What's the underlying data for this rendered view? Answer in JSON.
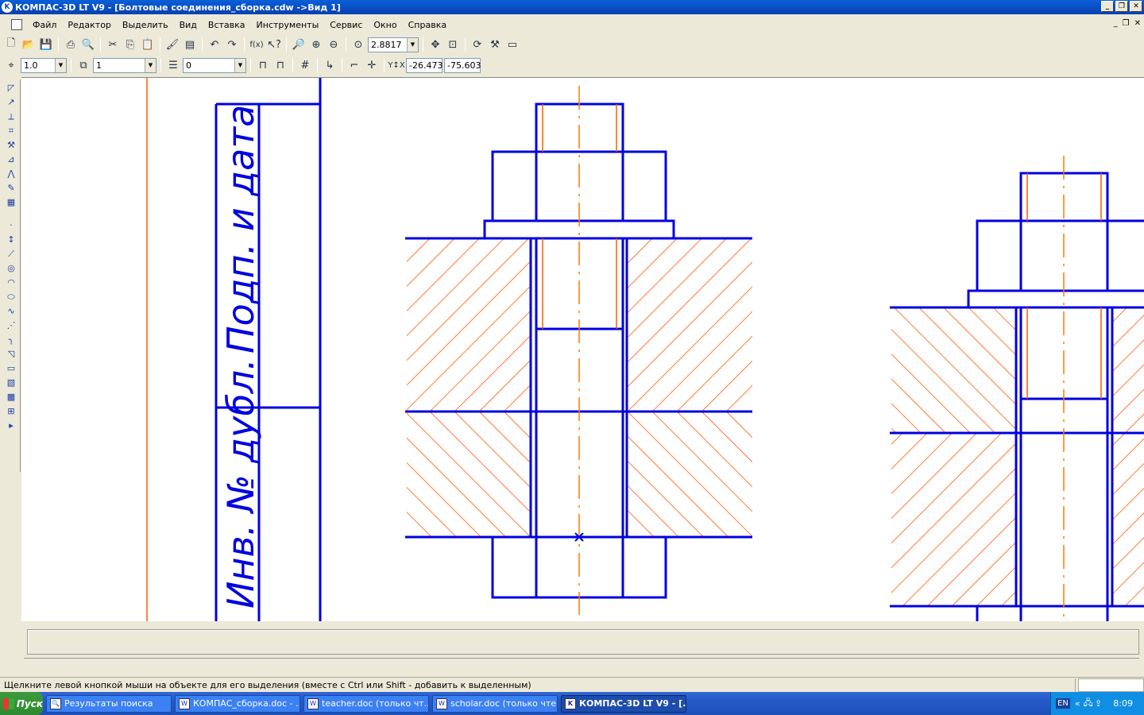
{
  "window": {
    "title": "КОМПАС-3D LT V9 - [Болтовые соединения_сборка.cdw ->Вид 1]",
    "app_icon": "kompas-icon"
  },
  "menu": {
    "items": [
      "Файл",
      "Редактор",
      "Выделить",
      "Вид",
      "Вставка",
      "Инструменты",
      "Сервис",
      "Окно",
      "Справка"
    ]
  },
  "toolbar": {
    "zoom_value": "2.8817",
    "icons": [
      "new-icon",
      "open-icon",
      "save-icon",
      "print-icon",
      "preview-icon",
      "cut-icon",
      "copy-icon",
      "paste-icon",
      "format-brush-icon",
      "properties-icon",
      "undo-icon",
      "redo-icon",
      "function-icon",
      "help-pointer-icon",
      "zoom-window-icon",
      "zoom-in-icon",
      "zoom-out-icon",
      "zoom-scale-icon",
      "pan-icon",
      "show-all-icon",
      "refresh-icon",
      "manager-icon",
      "layout-icon"
    ]
  },
  "toolbar2": {
    "step_value": "1.0",
    "view_value": "1",
    "layer_value": "0",
    "coord_x": "-26.473",
    "coord_y": "-75.603"
  },
  "drawing": {
    "stamp_text_1": "Подп. и дата",
    "stamp_text_2": "Инв. № дубл.",
    "line_color": "#0000e0",
    "hatch_color": "#ff5a00",
    "axis_color": "#ff7a00"
  },
  "status": {
    "message": "Щелкните левой кнопкой мыши на объекте для его выделения (вместе с Ctrl или Shift - добавить к выделенным)"
  },
  "taskbar": {
    "start_label": "Пуск",
    "tasks": [
      "Результаты поиска",
      "КОМПАС_сборка.doc - ...",
      "teacher.doc (только чт...",
      "scholar.doc (только чте...",
      "КОМПАС-3D LT V9 - [..."
    ],
    "lang": "EN",
    "time": "8:09"
  }
}
